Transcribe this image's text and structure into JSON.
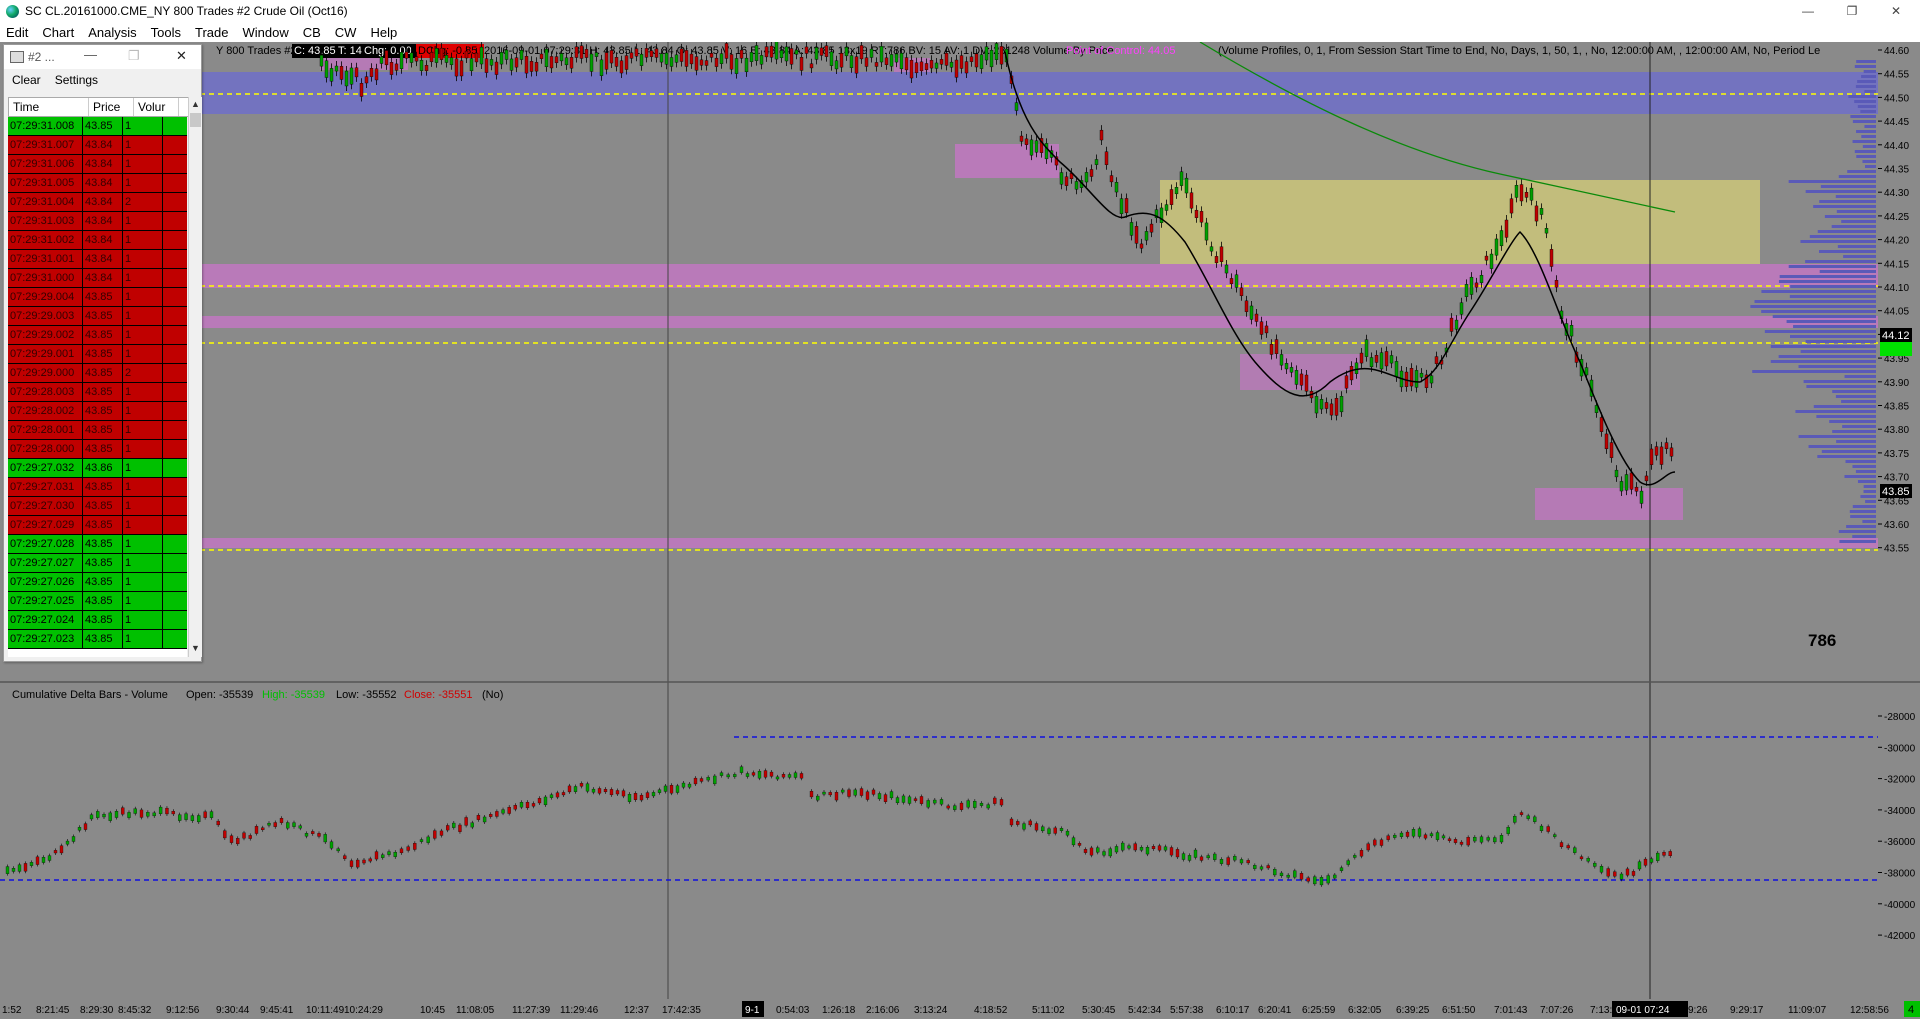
{
  "window": {
    "title": "SC CL.20161000.CME_NY  800 Trades  #2  Crude Oil (Oct16)",
    "minimize": "—",
    "restore": "❐",
    "close": "✕"
  },
  "menu": [
    "Edit",
    "Chart",
    "Analysis",
    "Tools",
    "Trade",
    "Window",
    "CB",
    "CW",
    "Help"
  ],
  "price_chart": {
    "header_prefix": "Y  800 Trades  #2",
    "close_tag": "C: 43.85",
    "trades_tag": "T: 14",
    "chg_tag": "Chg: 0.00",
    "dchg_tag": "DChg: -0.85",
    "header_main": "2016-09-01 07:29:31 H: 43.85 L: 43.84 O: 43.85 V: 16 B: 43.84 A: 43.85 13x19 RT:786 BV: 15 AV: 1 DV: 281248 Volume By Price",
    "poc_label": "Point of Control: 44.05",
    "header_tail": "(Volume Profiles, 0, 1, From Session Start Time to End, No, Days, 1, 50, 1, , No, 12:00:00 AM, , 12:00:00 AM, No, Period Le",
    "price_ticks": [
      "44.60",
      "44.55",
      "44.50",
      "44.45",
      "44.40",
      "44.35",
      "44.30",
      "44.25",
      "44.20",
      "44.15",
      "44.10",
      "44.05",
      "44.00",
      "43.95",
      "43.90",
      "43.85",
      "43.80",
      "43.75",
      "43.70",
      "43.65",
      "43.60",
      "43.55"
    ],
    "current_price_label": "43.85",
    "upper_price_label": "44.12",
    "countdown_label": "786",
    "colors": {
      "bull": "#00a000",
      "bear": "#c00000",
      "zone_blue": "#6f6fc8",
      "zone_pink": "#c874c8",
      "zone_yellow": "#c8c27a",
      "dashed": "#ffff00"
    }
  },
  "delta_panel": {
    "title": "Cumulative Delta Bars - Volume",
    "open": "Open: -35539",
    "high": "High: -35539",
    "low": "Low: -35552",
    "close": "Close: -35551",
    "suffix": "(No)",
    "ticks": [
      "-28000",
      "-30000",
      "-32000",
      "-34000",
      "-36000",
      "-38000",
      "-40000",
      "-42000"
    ]
  },
  "time_axis": {
    "labels": [
      "1:52",
      "8:21:45",
      "8:29:30",
      "8:45:32",
      "9:12:56",
      "9:30:44",
      "9:45:41",
      "10:11:49",
      "10:24:29",
      "10:45",
      "11:08:05",
      "11:27:39",
      "11:29:46",
      "12:37",
      "17:42:35",
      "0:54:03",
      "1:26:18",
      "2:16:06",
      "3:13:24",
      "4:18:52",
      "5:11:02",
      "5:30:45",
      "5:42:34",
      "5:57:38",
      "6:10:17",
      "6:20:41",
      "6:25:59",
      "6:32:05",
      "6:39:25",
      "6:51:50",
      "7:01:43",
      "7:07:26",
      "7:13:16",
      "7:18:",
      "9:26",
      "9:29:17",
      "11:09:07",
      "12:58:56"
    ],
    "day_marker": "9-1",
    "cursor_label": "09-01  07:24"
  },
  "corner_label": "4",
  "time_and_sales": {
    "title": "#2 ...",
    "clear": "Clear",
    "settings": "Settings",
    "headers": [
      "Time",
      "Price",
      "Volur"
    ],
    "rows": [
      {
        "time": "07:29:31.008",
        "price": "43.85",
        "vol": "1",
        "side": "buy"
      },
      {
        "time": "07:29:31.007",
        "price": "43.84",
        "vol": "1",
        "side": "sell"
      },
      {
        "time": "07:29:31.006",
        "price": "43.84",
        "vol": "1",
        "side": "sell"
      },
      {
        "time": "07:29:31.005",
        "price": "43.84",
        "vol": "1",
        "side": "sell"
      },
      {
        "time": "07:29:31.004",
        "price": "43.84",
        "vol": "2",
        "side": "sell"
      },
      {
        "time": "07:29:31.003",
        "price": "43.84",
        "vol": "1",
        "side": "sell"
      },
      {
        "time": "07:29:31.002",
        "price": "43.84",
        "vol": "1",
        "side": "sell"
      },
      {
        "time": "07:29:31.001",
        "price": "43.84",
        "vol": "1",
        "side": "sell"
      },
      {
        "time": "07:29:31.000",
        "price": "43.84",
        "vol": "1",
        "side": "sell"
      },
      {
        "time": "07:29:29.004",
        "price": "43.85",
        "vol": "1",
        "side": "sell"
      },
      {
        "time": "07:29:29.003",
        "price": "43.85",
        "vol": "1",
        "side": "sell"
      },
      {
        "time": "07:29:29.002",
        "price": "43.85",
        "vol": "1",
        "side": "sell"
      },
      {
        "time": "07:29:29.001",
        "price": "43.85",
        "vol": "1",
        "side": "sell"
      },
      {
        "time": "07:29:29.000",
        "price": "43.85",
        "vol": "2",
        "side": "sell"
      },
      {
        "time": "07:29:28.003",
        "price": "43.85",
        "vol": "1",
        "side": "sell"
      },
      {
        "time": "07:29:28.002",
        "price": "43.85",
        "vol": "1",
        "side": "sell"
      },
      {
        "time": "07:29:28.001",
        "price": "43.85",
        "vol": "1",
        "side": "sell"
      },
      {
        "time": "07:29:28.000",
        "price": "43.85",
        "vol": "1",
        "side": "sell"
      },
      {
        "time": "07:29:27.032",
        "price": "43.86",
        "vol": "1",
        "side": "buy"
      },
      {
        "time": "07:29:27.031",
        "price": "43.85",
        "vol": "1",
        "side": "sell"
      },
      {
        "time": "07:29:27.030",
        "price": "43.85",
        "vol": "1",
        "side": "sell"
      },
      {
        "time": "07:29:27.029",
        "price": "43.85",
        "vol": "1",
        "side": "sell"
      },
      {
        "time": "07:29:27.028",
        "price": "43.85",
        "vol": "1",
        "side": "buy"
      },
      {
        "time": "07:29:27.027",
        "price": "43.85",
        "vol": "1",
        "side": "buy"
      },
      {
        "time": "07:29:27.026",
        "price": "43.85",
        "vol": "1",
        "side": "buy"
      },
      {
        "time": "07:29:27.025",
        "price": "43.85",
        "vol": "1",
        "side": "buy"
      },
      {
        "time": "07:29:27.024",
        "price": "43.85",
        "vol": "1",
        "side": "buy"
      },
      {
        "time": "07:29:27.023",
        "price": "43.85",
        "vol": "1",
        "side": "buy"
      }
    ]
  }
}
